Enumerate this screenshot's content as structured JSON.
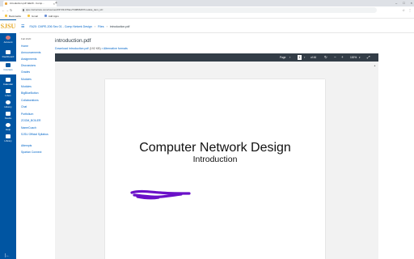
{
  "browser": {
    "tab_title": "introduction.pdf: EE29 - Comp...",
    "url": "sjsu.instructure.com/courses/1572317/files/73089645?module_item_id=",
    "bookmarks": [
      "Bookmarks",
      "Gmail",
      "Add Apps"
    ]
  },
  "global_nav": {
    "logo": "SJSU",
    "items": [
      {
        "label": "Account"
      },
      {
        "label": "Dashboard"
      },
      {
        "label": "Courses"
      },
      {
        "label": "Calendar"
      },
      {
        "label": "Inbox"
      },
      {
        "label": "History"
      },
      {
        "label": "Studio"
      },
      {
        "label": "Help"
      },
      {
        "label": "Library"
      }
    ]
  },
  "breadcrumb": {
    "course": "FA20: CMPE-206 Sec 01 - Comp Netwrk Design",
    "section": "Files",
    "current": "introduction.pdf"
  },
  "course_nav": {
    "term": "Fall 2020",
    "items": [
      "Home",
      "Announcements",
      "Assignments",
      "Discussions",
      "Grades",
      "Modules",
      "Modules",
      "BigBlueButton",
      "Collaborations",
      "Chat",
      "Portfolium",
      "ZOOM_BOILER",
      "NameCoach",
      "SJSU Official Syllabus",
      "Attempts",
      "Spartan Connect"
    ]
  },
  "file": {
    "title": "introduction.pdf",
    "download_label": "Download introduction.pdf",
    "size": "(192 KB)",
    "alt_formats": "Alternative formats"
  },
  "viewer": {
    "page_label": "Page",
    "page_value": "1",
    "page_total": "of 46",
    "zoom": "100%",
    "pdf_title": "Computer Network Design",
    "pdf_subtitle": "Introduction"
  }
}
